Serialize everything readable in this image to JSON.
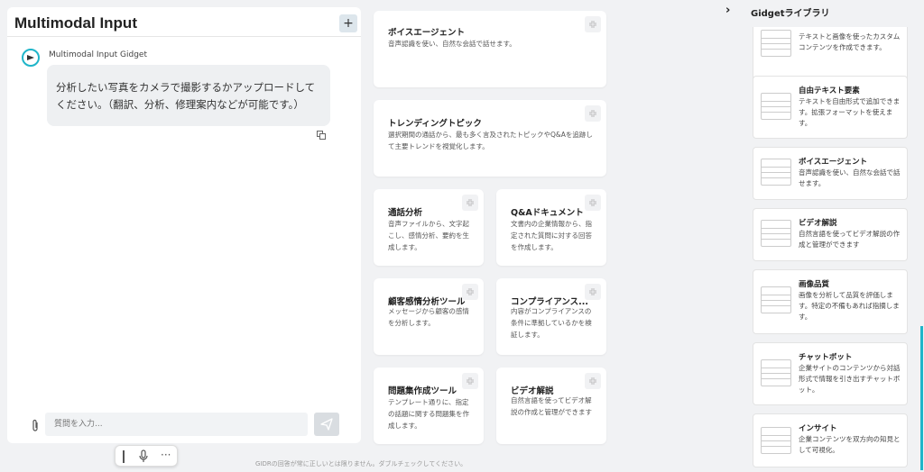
{
  "chat": {
    "title": "Multimodal Input",
    "add_label": "+",
    "bot_name": "Multimodal Input Gidget",
    "message": "分析したい写真をカメラで撮影するかアップロードしてください。（翻訳、分析、修理案内などが可能です。）",
    "input_placeholder": "質問を入力...",
    "footer_note": "GIDRの回答が常に正しいとは限りません。ダブルチェックしてください。"
  },
  "gadgets": [
    {
      "title": "ボイスエージェント",
      "desc": "音声認識を使い、自然な会話で話せます。"
    },
    {
      "title": "トレンディングトピック",
      "desc": "選択期間の通話から、最も多く言及されたトピックやQ&Aを追跡して主要トレンドを視覚化します。"
    },
    {
      "title": "通話分析",
      "desc": "音声ファイルから、文字起こし、感情分析、要約を生成します。"
    },
    {
      "title": "Q&Aドキュメント",
      "desc": "文書内の企業情報から、指定された質問に対する回答を作成します。"
    },
    {
      "title": "顧客感情分析ツール",
      "desc": "メッセージから顧客の感情を分析します。"
    },
    {
      "title": "コンプライアンス...",
      "desc": "内容がコンプライアンスの条件に準拠しているかを検証します。"
    },
    {
      "title": "問題集作成ツール",
      "desc": "テンプレート通りに、指定の話題に関する問題集を作成します。"
    },
    {
      "title": "ビデオ解説",
      "desc": "自然言語を使ってビデオ解説の作成と管理ができます"
    }
  ],
  "library": {
    "title": "Gidgetライブラリ",
    "items": [
      {
        "name": "",
        "desc": "テキストと画像を使ったカスタムコンテンツを作成できます。"
      },
      {
        "name": "自由テキスト要素",
        "desc": "テキストを自由形式で追加できます。拡張フォーマットを使えます。"
      },
      {
        "name": "ボイスエージェント",
        "desc": "音声認識を使い、自然な会話で話せます。"
      },
      {
        "name": "ビデオ解説",
        "desc": "自然言語を使ってビデオ解説の作成と管理ができます"
      },
      {
        "name": "画像品質",
        "desc": "画像を分析して品質を評価します。特定の不備もあれば指摘します。"
      },
      {
        "name": "チャットボット",
        "desc": "企業サイトのコンテンツから対話形式で情報を引き出すチャットボット。"
      },
      {
        "name": "インサイト",
        "desc": "企業コンテンツを双方向の知見として可視化。"
      }
    ]
  },
  "colors": {
    "accent": "#1fb5c9",
    "panel": "#ffffff",
    "background": "#f1f2f4"
  },
  "icons": [
    "plus-icon",
    "bot-avatar-icon",
    "copy-icon",
    "paperclip-icon",
    "send-icon",
    "microphone-icon",
    "more-icon",
    "collapse-icon",
    "chevron-right-icon",
    "document-thumbnail-icon"
  ]
}
